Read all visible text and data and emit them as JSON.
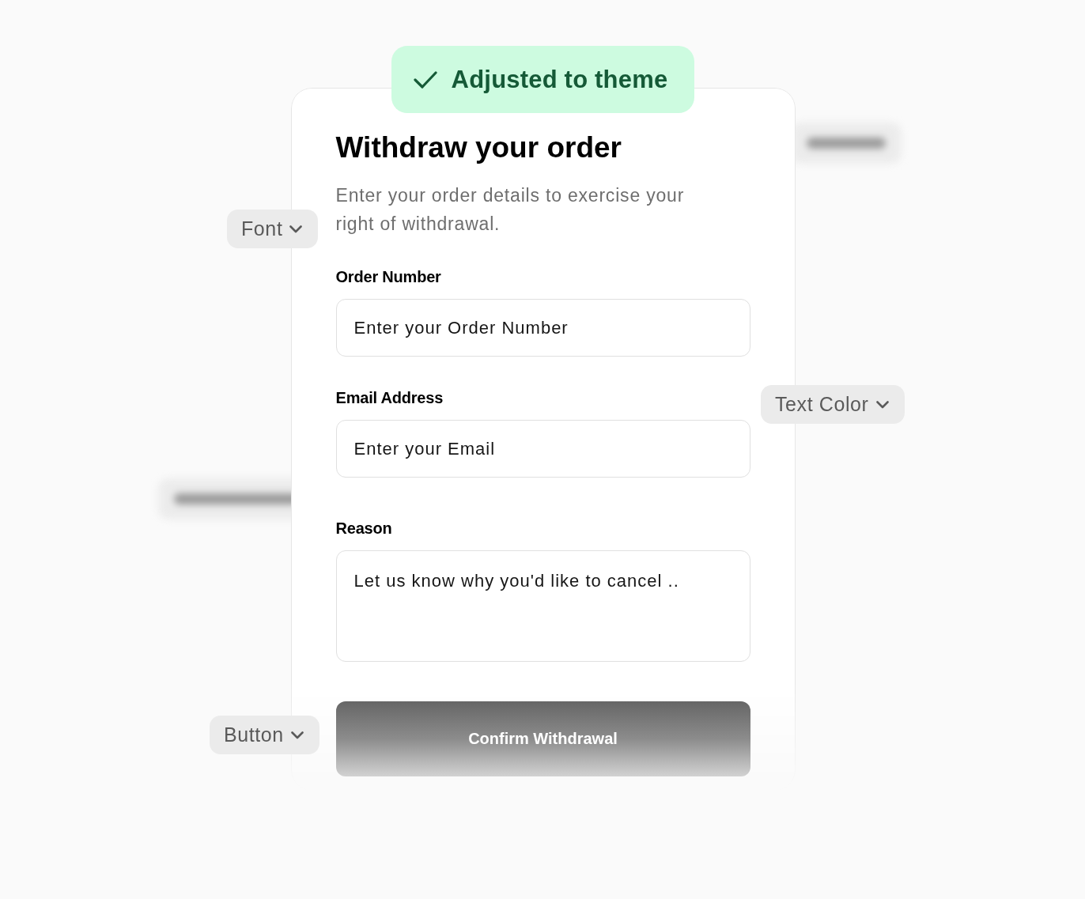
{
  "badge": {
    "text": "Adjusted to theme"
  },
  "form": {
    "title": "Withdraw your order",
    "description": "Enter your order details to exercise your right of withdrawal.",
    "fields": [
      {
        "kind": "input",
        "label": "Order Number",
        "placeholder": "Enter your Order Number"
      },
      {
        "kind": "input",
        "label": "Email Address",
        "placeholder": "Enter your Email"
      },
      {
        "kind": "textarea",
        "label": "Reason",
        "placeholder": "Let us know why you'd like to cancel .."
      }
    ],
    "submit": "Confirm Withdrawal"
  },
  "option_chips": [
    {
      "label": "Font"
    },
    {
      "label": "Text Color"
    },
    {
      "label": "Button"
    }
  ]
}
